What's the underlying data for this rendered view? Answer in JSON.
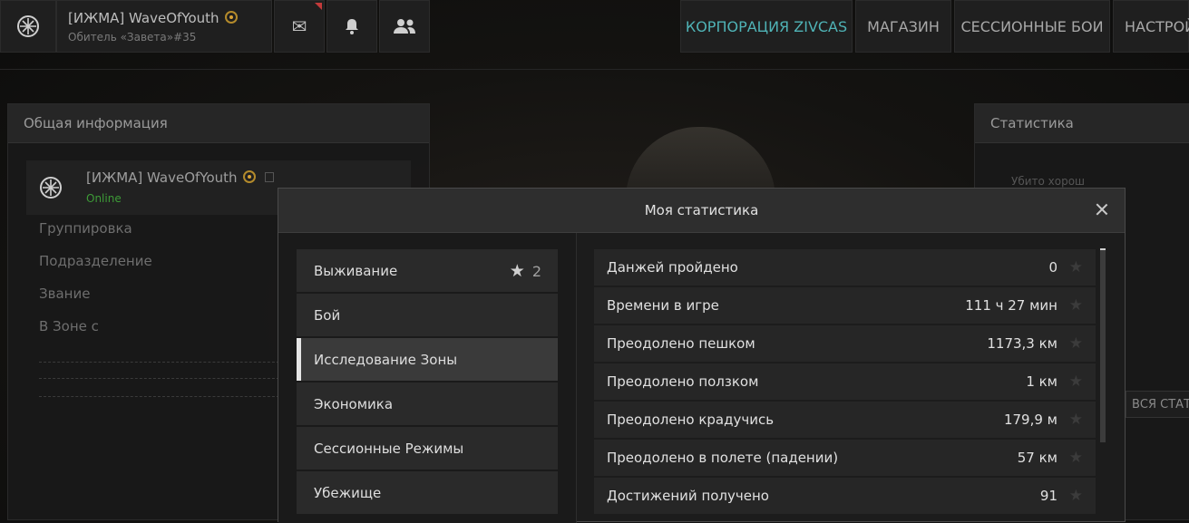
{
  "topbar": {
    "player_name": "[ИЖМА] WaveOfYouth",
    "player_sub": "Обитель «Завета»#35",
    "nav": [
      "КОРПОРАЦИЯ ZIVCAS",
      "МАГАЗИН",
      "СЕССИОННЫЕ БОИ",
      "НАСТРОЙ"
    ]
  },
  "general_panel": {
    "title": "Общая информация",
    "player_name": "[ИЖМА] WaveOfYouth",
    "status": "Online",
    "fields": [
      "Группировка",
      "Подразделение",
      "Звание",
      "В Зоне с"
    ]
  },
  "stats_panel": {
    "title": "Статистика",
    "killed_label": "Убито хорош",
    "all_stats_button": "ВСЯ СТАТ"
  },
  "modal": {
    "title": "Моя статистика",
    "categories": [
      {
        "label": "Выживание",
        "count": "2"
      },
      {
        "label": "Бой"
      },
      {
        "label": "Исследование Зоны"
      },
      {
        "label": "Экономика"
      },
      {
        "label": "Сессионные Режимы"
      },
      {
        "label": "Убежище"
      }
    ],
    "active_category": "Исследование Зоны",
    "stats": [
      {
        "label": "Данжей пройдено",
        "value": "0"
      },
      {
        "label": "Времени в игре",
        "value": "111 ч 27 мин"
      },
      {
        "label": "Преодолено пешком",
        "value": "1173,3 км"
      },
      {
        "label": "Преодолено ползком",
        "value": "1 км"
      },
      {
        "label": "Преодолено крадучись",
        "value": "179,9 м"
      },
      {
        "label": "Преодолено в полете (падении)",
        "value": "57 км"
      },
      {
        "label": "Достижений получено",
        "value": "91"
      }
    ]
  },
  "colors": {
    "accent": "#4fb3b6",
    "online": "#3d9b37",
    "badge": "#b38a2b"
  }
}
